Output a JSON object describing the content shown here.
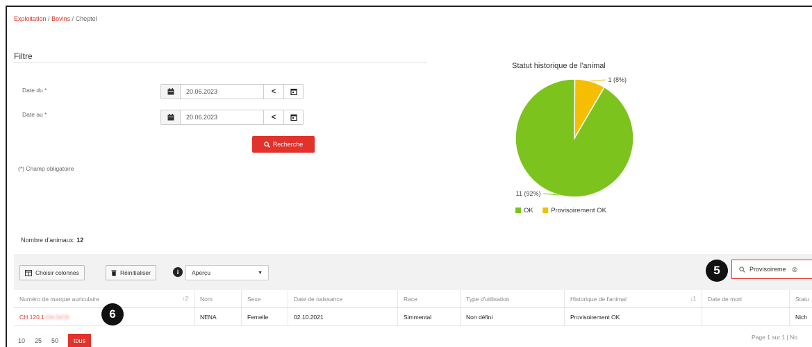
{
  "breadcrumb": {
    "item1": "Exploitation",
    "item2": "Bovins",
    "item3": "Cheptel",
    "sep": "/"
  },
  "filter": {
    "title": "Filtre",
    "date_from_label": "Date du",
    "date_to_label": "Date au",
    "required_mark": "*",
    "date_from_value": "20.06.2023",
    "date_to_value": "20.06.2023",
    "prev_glyph": "<",
    "search_button": "Recherche",
    "required_note": "(*) Champ obligatoire"
  },
  "chart_data": {
    "type": "pie",
    "title": "Statut historique de l'animal",
    "slices": [
      {
        "name": "OK",
        "value": 11,
        "label": "11 (92%)",
        "color": "#7dc31e"
      },
      {
        "name": "Provisoirement OK",
        "value": 1,
        "label": "1 (8%)",
        "color": "#f5be00"
      }
    ],
    "legend_position": "bottom"
  },
  "animals_count": {
    "label": "Nombre d'animaux:",
    "value": "12"
  },
  "toolbar": {
    "choose_columns": "Choisir colonnes",
    "reset": "Réinitialiser",
    "view_select": "Aperçu",
    "search_value": "Provisoireme"
  },
  "callouts": {
    "five": "5",
    "six": "6"
  },
  "table": {
    "headers": {
      "ear_tag": "Numéro de marque auriculaire",
      "ear_sort": "↑2",
      "name": "Nom",
      "sex": "Sexe",
      "birth": "Date de naissance",
      "race": "Race",
      "usage": "Type d'utilisation",
      "history": "Historique de l'animal",
      "history_sort": "↓1",
      "death": "Date de mort",
      "status": "Statu"
    },
    "row": {
      "ear_prefix": "CH 120.1",
      "ear_hidden": "234.5678",
      "name": "NENA",
      "sex": "Femelle",
      "birth": "02.10.2021",
      "race": "Simmental",
      "usage": "Non défini",
      "history": "Provisoirement OK",
      "death": "",
      "status": "Nich"
    }
  },
  "pager": {
    "opt1": "10",
    "opt2": "25",
    "opt3": "50",
    "opt4": "tous",
    "info": "Page 1 sur 1 | No"
  },
  "colors": {
    "accent": "#e2322b",
    "ok": "#7dc31e",
    "prov": "#f5be00"
  }
}
